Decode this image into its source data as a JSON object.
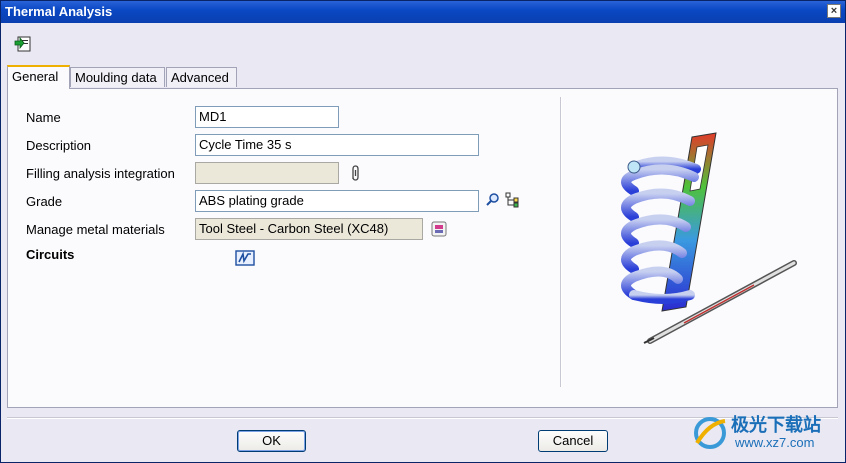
{
  "window": {
    "title": "Thermal Analysis",
    "close_glyph": "×"
  },
  "toolbar": {
    "save_icon": "save-document-icon"
  },
  "tabs": [
    {
      "label": "General",
      "active": true
    },
    {
      "label": "Moulding data",
      "active": false
    },
    {
      "label": "Advanced",
      "active": false
    }
  ],
  "form": {
    "name_label": "Name",
    "name_value": "MD1",
    "description_label": "Description",
    "description_value": "Cycle Time 35 s",
    "filling_label": "Filling analysis integration",
    "filling_value": "",
    "grade_label": "Grade",
    "grade_value": "ABS plating grade",
    "metal_label": "Manage metal materials",
    "metal_value": "Tool Steel - Carbon Steel (XC48)",
    "circuits_label": "Circuits"
  },
  "buttons": {
    "ok": "OK",
    "cancel": "Cancel"
  },
  "watermark": {
    "line1": "极光下载站",
    "line2": "www.xz7.com"
  },
  "colors": {
    "titlebar": "#0a48c4",
    "tab_active_accent": "#f0b000",
    "coil": "#2a3fd8"
  }
}
